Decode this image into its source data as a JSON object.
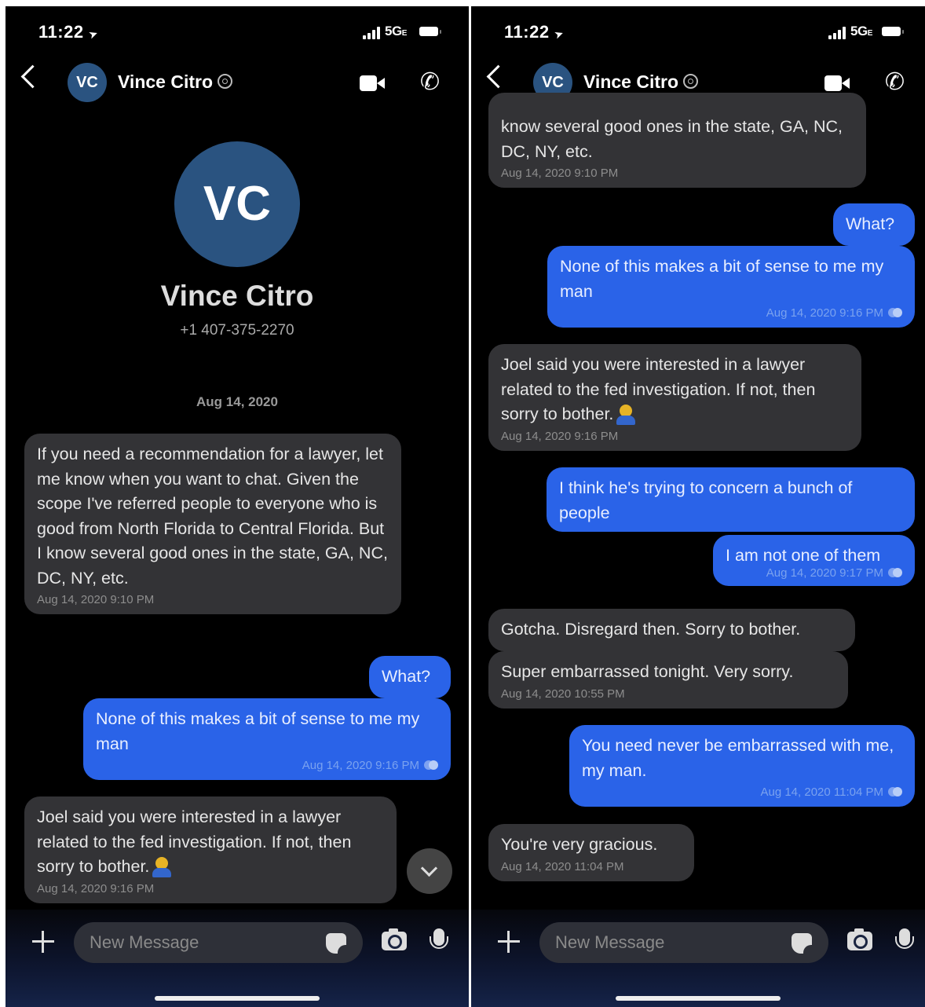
{
  "status_bar": {
    "time": "11:22",
    "network": "5G",
    "network_suffix": "E"
  },
  "contact": {
    "initials": "VC",
    "name": "Vince Citro",
    "phone": "+1 407-375-2270"
  },
  "thread": {
    "date_header": "Aug 14, 2020"
  },
  "composer": {
    "placeholder": "New Message"
  },
  "left_messages": [
    {
      "dir": "in",
      "text": "If you need a recommendation for a lawyer, let me know when you want to chat. Given the scope I've referred people to everyone who is good from North Florida to Central Florida. But I know several good ones in the state, GA, NC, DC, NY, etc.",
      "time": "Aug 14, 2020 9:10 PM"
    },
    {
      "dir": "out",
      "text": "What?",
      "time": ""
    },
    {
      "dir": "out",
      "text": "None of this makes a bit of sense to me my man",
      "time": "Aug 14, 2020 9:16 PM"
    },
    {
      "dir": "in",
      "text": "Joel said you were interested in a lawyer related to the fed investigation. If not, then sorry to bother.",
      "time": "Aug 14, 2020 9:16 PM",
      "emoji": "man-judge-emoji"
    }
  ],
  "right_messages": [
    {
      "dir": "in",
      "text": "know several good ones in the state, GA, NC, DC, NY, etc.",
      "time": "Aug 14, 2020 9:10 PM"
    },
    {
      "dir": "out",
      "text": "What?",
      "time": ""
    },
    {
      "dir": "out",
      "text": "None of this makes a bit of sense to me my man",
      "time": "Aug 14, 2020 9:16 PM"
    },
    {
      "dir": "in",
      "text": "Joel said you were interested in a lawyer related to the fed investigation. If not, then sorry to bother.",
      "time": "Aug 14, 2020 9:16 PM",
      "emoji": "man-judge-emoji"
    },
    {
      "dir": "out",
      "text": "I think he's trying to concern a bunch of people",
      "time": ""
    },
    {
      "dir": "out",
      "text": "I am not one of them",
      "time": "Aug 14, 2020 9:17 PM"
    },
    {
      "dir": "in",
      "text": "Gotcha. Disregard then. Sorry to bother.",
      "time": ""
    },
    {
      "dir": "in",
      "text": "Super embarrassed tonight. Very sorry.",
      "time": "Aug 14, 2020 10:55 PM"
    },
    {
      "dir": "out",
      "text": "You need never be embarrassed with me, my man.",
      "time": "Aug 14, 2020 11:04 PM"
    },
    {
      "dir": "in",
      "text": "You're very gracious.",
      "time": "Aug 14, 2020 11:04 PM"
    }
  ],
  "colors": {
    "incoming_bubble": "#333336",
    "outgoing_bubble": "#2a63e8",
    "avatar": "#2a5380",
    "background": "#000000"
  },
  "icons": [
    "back-icon",
    "location-arrow-icon",
    "signal-icon",
    "battery-icon",
    "video-call-icon",
    "phone-call-icon",
    "at-sign-icon",
    "chevron-down-icon",
    "plus-icon",
    "sticker-icon",
    "camera-icon",
    "microphone-icon",
    "read-receipt-icon"
  ]
}
